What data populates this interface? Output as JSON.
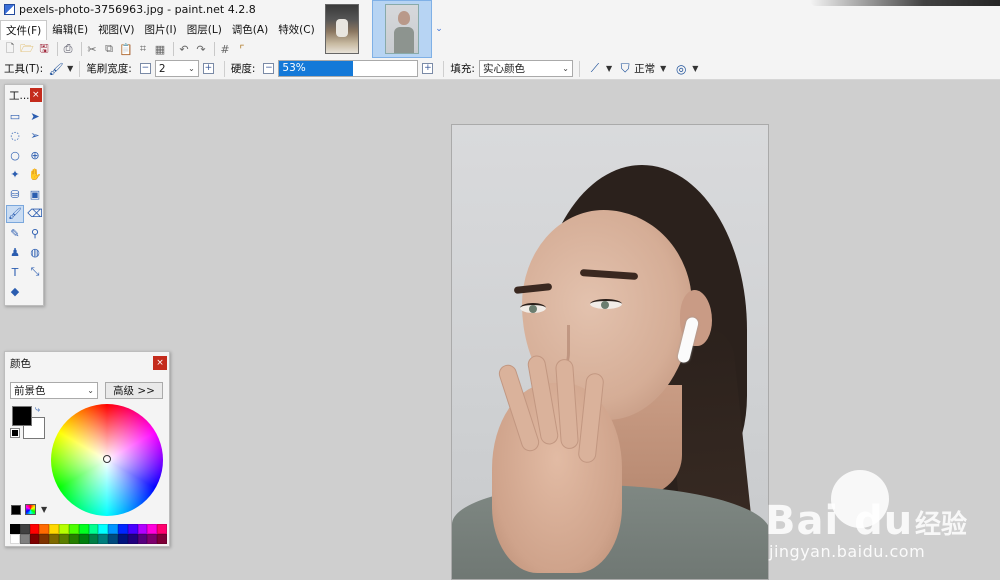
{
  "window": {
    "title": "pexels-photo-3756963.jpg - paint.net 4.2.8"
  },
  "menu": {
    "items": [
      "文件(F)",
      "编辑(E)",
      "视图(V)",
      "图片(I)",
      "图层(L)",
      "调色(A)",
      "特效(C)"
    ]
  },
  "toolbar": {
    "icons": [
      "new-icon",
      "open-icon",
      "save-icon",
      "print-icon",
      "cut-icon",
      "copy-icon",
      "paste-icon",
      "crop-icon",
      "deselect-icon",
      "undo-icon",
      "redo-icon",
      "grid-icon",
      "ruler-icon"
    ]
  },
  "options": {
    "tool_label": "工具(T):",
    "brush_width_label": "笔刷宽度:",
    "brush_width_value": "2",
    "hardness_label": "硬度:",
    "hardness_value": "53%",
    "hardness_fraction": 0.53,
    "fill_label": "填充:",
    "fill_value": "实心颜色",
    "blend_mode": "正常"
  },
  "tools_window": {
    "title": "工...",
    "close": "×",
    "tools": [
      {
        "name": "rectangle-select-icon",
        "glyph": "▭",
        "active": false
      },
      {
        "name": "move-selection-icon",
        "glyph": "➤",
        "active": false
      },
      {
        "name": "lasso-select-icon",
        "glyph": "◌",
        "active": false
      },
      {
        "name": "move-selected-icon",
        "glyph": "➢",
        "active": false
      },
      {
        "name": "ellipse-select-icon",
        "glyph": "○",
        "active": false
      },
      {
        "name": "zoom-icon",
        "glyph": "⊕",
        "active": false
      },
      {
        "name": "magic-wand-icon",
        "glyph": "✦",
        "active": false
      },
      {
        "name": "pan-icon",
        "glyph": "✋",
        "active": false
      },
      {
        "name": "paint-bucket-icon",
        "glyph": "⛁",
        "active": false
      },
      {
        "name": "gradient-icon",
        "glyph": "▣",
        "active": false
      },
      {
        "name": "paintbrush-icon",
        "glyph": "🖌",
        "active": true
      },
      {
        "name": "eraser-icon",
        "glyph": "⌫",
        "active": false
      },
      {
        "name": "pencil-icon",
        "glyph": "✎",
        "active": false
      },
      {
        "name": "color-picker-icon",
        "glyph": "⚲",
        "active": false
      },
      {
        "name": "clone-stamp-icon",
        "glyph": "♟",
        "active": false
      },
      {
        "name": "recolor-icon",
        "glyph": "◍",
        "active": false
      },
      {
        "name": "text-icon",
        "glyph": "T",
        "active": false
      },
      {
        "name": "line-curve-icon",
        "glyph": "⤡",
        "active": false
      },
      {
        "name": "shapes-icon",
        "glyph": "◆",
        "active": false
      }
    ]
  },
  "colors_window": {
    "title": "颜色",
    "close": "×",
    "mode": "前景色",
    "advanced_label": "高级 >>",
    "primary_color": "#000000",
    "secondary_color": "#ffffff",
    "palette": [
      "#000000",
      "#404040",
      "#ff0000",
      "#ff6a00",
      "#ffd800",
      "#b6ff00",
      "#4cff00",
      "#00ff21",
      "#00ff90",
      "#00ffff",
      "#0094ff",
      "#0026ff",
      "#4800ff",
      "#b200ff",
      "#ff00dc",
      "#ff006e",
      "#ffffff",
      "#808080",
      "#7f0000",
      "#7f3300",
      "#7f6a00",
      "#5b7f00",
      "#267f00",
      "#007f0e",
      "#007f46",
      "#007f7f",
      "#004a7f",
      "#00137f",
      "#21007f",
      "#57007f",
      "#7f006e",
      "#7f0037"
    ]
  },
  "watermark": {
    "logo": "Bai  du",
    "text": "经验",
    "url": "jingyan.baidu.com"
  }
}
